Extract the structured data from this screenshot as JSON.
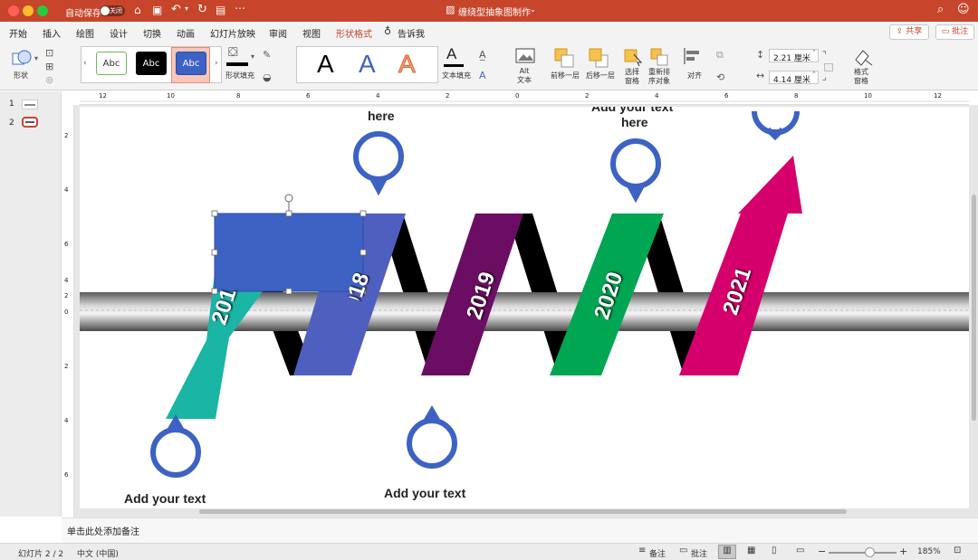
{
  "titlebar": {
    "autosave_label": "自动保存",
    "toggle_label": "关闭",
    "doc_title": "缠绕型抽象图制作"
  },
  "tabs": [
    "开始",
    "插入",
    "绘图",
    "设计",
    "切换",
    "动画",
    "幻灯片放映",
    "审阅",
    "视图",
    "形状格式",
    "告诉我"
  ],
  "active_tab": "形状格式",
  "tab_buttons": {
    "share": "共享",
    "comments": "批注"
  },
  "ribbon": {
    "shape_label": "形状",
    "style_samples": [
      "Abc",
      "Abc",
      "Abc"
    ],
    "shape_fill_label": "形状填充",
    "wordart_samples": [
      "A",
      "A",
      "A"
    ],
    "text_fill_label": "文本填充",
    "alt_text_label": "Alt\n文本",
    "bring_forward_label": "前移一层",
    "send_backward_label": "后移一层",
    "selection_pane_label": "选择\n窗格",
    "reorder_label": "重新排\n序对象",
    "align_label": "对齐",
    "height_value": "2.21 厘米",
    "width_value": "4.14 厘米",
    "format_pane_label": "格式\n窗格",
    "colors": {
      "accent": "#c7452b"
    }
  },
  "ruler": {
    "ticks": [
      "12",
      "10",
      "8",
      "6",
      "4",
      "2",
      "0",
      "2",
      "4",
      "6",
      "8",
      "10",
      "12"
    ]
  },
  "vruler": {
    "ticks": [
      "2",
      "4",
      "6",
      "4",
      "2",
      "0",
      "2",
      "4",
      "6"
    ]
  },
  "thumbnails": [
    {
      "num": "1"
    },
    {
      "num": "2"
    }
  ],
  "slide": {
    "years": [
      "2018",
      "2019",
      "2020",
      "2021",
      "201"
    ],
    "texts": {
      "top_left_here": "here",
      "top_right_line1": "Add your text",
      "top_right_here": "here",
      "bottom_left": "Add your text",
      "bottom_center": "Add your text"
    },
    "colors": {
      "teal": "#1ab5a4",
      "blue": "#4f5fbf",
      "purple": "#6b0e63",
      "green": "#00a651",
      "magenta": "#d6006c",
      "pin": "#3d62c4",
      "selected_rect": "#3d62c4"
    }
  },
  "notes": {
    "placeholder": "单击此处添加备注"
  },
  "statusbar": {
    "slide_info": "幻灯片 2 / 2",
    "language": "中文 (中国)",
    "notes_btn": "备注",
    "comments_btn": "批注",
    "zoom": "185%"
  }
}
